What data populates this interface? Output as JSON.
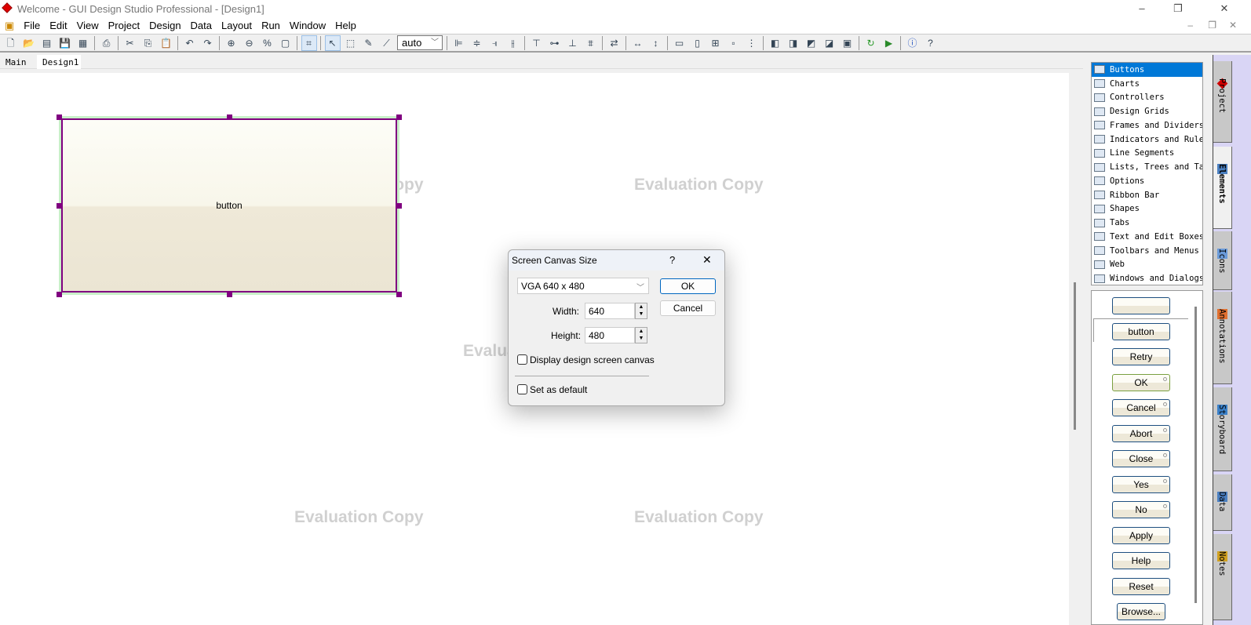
{
  "window": {
    "title": "Welcome - GUI Design Studio Professional - [Design1]",
    "controls": [
      "–",
      "❐",
      "✕"
    ]
  },
  "menu": [
    "File",
    "Edit",
    "View",
    "Project",
    "Design",
    "Data",
    "Layout",
    "Run",
    "Window",
    "Help"
  ],
  "toolbar": {
    "zoom_value": "auto",
    "icons": [
      [
        "new-icon",
        "🗋"
      ],
      [
        "open-icon",
        "📂"
      ],
      [
        "open-project-icon",
        "▤"
      ],
      [
        "save-icon",
        "💾"
      ],
      [
        "save-all-icon",
        "▦"
      ],
      "|",
      [
        "print-icon",
        "⎙"
      ],
      "|",
      [
        "cut-icon",
        "✂"
      ],
      [
        "copy-icon",
        "⎘"
      ],
      [
        "paste-icon",
        "📋"
      ],
      "|",
      [
        "undo-icon",
        "↶"
      ],
      [
        "redo-icon",
        "↷"
      ],
      "|",
      [
        "zoom-in-icon",
        "⊕"
      ],
      [
        "zoom-out-icon",
        "⊖"
      ],
      [
        "zoom-100-icon",
        "%"
      ],
      [
        "zoom-fit-icon",
        "▢"
      ],
      "|",
      [
        "snap-grid-icon",
        "⌗"
      ],
      "|",
      [
        "select-pointer-icon",
        "↖"
      ],
      [
        "select-area-icon",
        "⬚"
      ],
      [
        "edit-properties-icon",
        "✎"
      ],
      [
        "connector-icon",
        "⟋"
      ],
      "ZOOM",
      "|",
      [
        "align-left-icon",
        "⊫"
      ],
      [
        "align-center-icon",
        "≑"
      ],
      [
        "align-right-icon",
        "⫣"
      ],
      [
        "distribute-horizontal-icon",
        "⫲"
      ],
      "|",
      [
        "align-top-icon",
        "⊤"
      ],
      [
        "align-middle-icon",
        "⊶"
      ],
      [
        "align-bottom-icon",
        "⊥"
      ],
      [
        "distribute-vertical-icon",
        "⩨"
      ],
      "|",
      [
        "swap-icon",
        "⇄"
      ],
      "|",
      [
        "same-width-icon",
        "↔"
      ],
      [
        "same-height-icon",
        "↕"
      ],
      "|",
      [
        "space-across-icon",
        "▭"
      ],
      [
        "space-down-icon",
        "▯"
      ],
      [
        "center-both-icon",
        "⊞"
      ],
      [
        "space-evenly-h-icon",
        "▫"
      ],
      [
        "space-evenly-v-icon",
        "⋮"
      ],
      "|",
      [
        "bring-front-icon",
        "◧"
      ],
      [
        "bring-forward-icon",
        "◨"
      ],
      [
        "send-backward-icon",
        "◩"
      ],
      [
        "send-back-icon",
        "◪"
      ],
      [
        "group-icon",
        "▣"
      ],
      "|",
      [
        "refresh-icon",
        "↻"
      ],
      [
        "run-icon",
        "▶"
      ],
      "|",
      [
        "info-icon",
        "ⓘ"
      ],
      [
        "context-help-icon",
        "?"
      ]
    ]
  },
  "tabs": [
    "Main",
    "Design1"
  ],
  "canvas": {
    "button_label": "button",
    "watermark": "Evaluation Copy"
  },
  "dialog": {
    "title": "Screen Canvas Size",
    "help": "?",
    "close": "✕",
    "preset": "VGA 640 x 480",
    "width_label": "Width:",
    "width_value": "640",
    "height_label": "Height:",
    "height_value": "480",
    "display_canvas": "Display design screen canvas",
    "set_default": "Set as default",
    "ok": "OK",
    "cancel": "Cancel",
    "display_canvas_checked": false,
    "set_default_checked": false
  },
  "elements": {
    "categories": [
      "Buttons",
      "Charts",
      "Controllers",
      "Design Grids",
      "Frames and Dividers",
      "Indicators and Rule",
      "Line Segments",
      "Lists, Trees and Ta",
      "Options",
      "Ribbon Bar",
      "Shapes",
      "Tabs",
      "Text and Edit Boxes",
      "Toolbars and Menus",
      "Web",
      "Windows and Dialogs"
    ],
    "selected": "Buttons",
    "buttons": [
      "",
      "button",
      "Retry",
      "OK",
      "Cancel",
      "Abort",
      "Close",
      "Yes",
      "No",
      "Apply",
      "Help",
      "Reset",
      "Browse..."
    ]
  },
  "side_tabs": [
    {
      "label": "Project",
      "icon": "project-diamond-icon",
      "color": "#d00000"
    },
    {
      "label": "Elements",
      "icon": "elements-icon",
      "color": "#4a7fc0",
      "active": true
    },
    {
      "label": "Icons",
      "icon": "icons-icon",
      "color": "#6a9ad8"
    },
    {
      "label": "Annotations",
      "icon": "tag-icon",
      "color": "#e07030"
    },
    {
      "label": "Storyboard",
      "icon": "film-icon",
      "color": "#3a80c8"
    },
    {
      "label": "Data",
      "icon": "table-icon",
      "color": "#4a7fc0"
    },
    {
      "label": "Notes",
      "icon": "notes-icon",
      "color": "#d0a020"
    }
  ]
}
